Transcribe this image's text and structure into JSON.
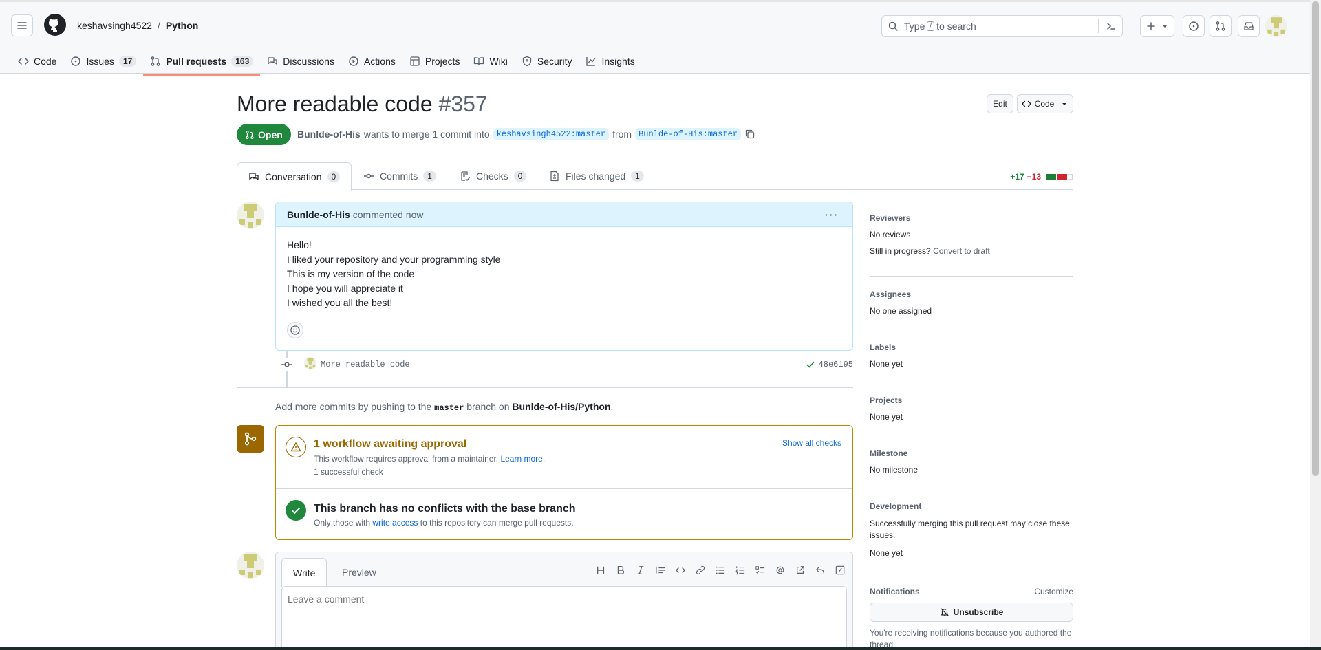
{
  "header": {
    "owner": "keshavsingh4522",
    "separator": "/",
    "repo": "Python",
    "search_placeholder_prefix": "Type",
    "search_key": "/",
    "search_placeholder_suffix": "to search"
  },
  "repo_nav": [
    {
      "label": "Code",
      "icon": "code-icon"
    },
    {
      "label": "Issues",
      "count": "17",
      "icon": "issue-icon"
    },
    {
      "label": "Pull requests",
      "count": "163",
      "icon": "pull-request-icon",
      "active": true
    },
    {
      "label": "Discussions",
      "icon": "discussions-icon"
    },
    {
      "label": "Actions",
      "icon": "play-icon"
    },
    {
      "label": "Projects",
      "icon": "table-icon"
    },
    {
      "label": "Wiki",
      "icon": "book-icon"
    },
    {
      "label": "Security",
      "icon": "shield-icon"
    },
    {
      "label": "Insights",
      "icon": "graph-icon"
    }
  ],
  "pr": {
    "title": "More readable code",
    "number": "#357",
    "edit_label": "Edit",
    "code_label": "Code",
    "state": "Open",
    "author": "Bunlde-of-His",
    "merge_text": "wants to merge 1 commit into",
    "base_branch": "keshavsingh4522:master",
    "from_text": "from",
    "head_branch": "Bunlde-of-His:master"
  },
  "tabs": [
    {
      "label": "Conversation",
      "count": "0",
      "icon": "conversation-icon"
    },
    {
      "label": "Commits",
      "count": "1",
      "icon": "commit-icon"
    },
    {
      "label": "Checks",
      "count": "0",
      "icon": "checklist-icon"
    },
    {
      "label": "Files changed",
      "count": "1",
      "icon": "file-diff-icon"
    }
  ],
  "diffstat": {
    "additions": "+17",
    "deletions": "−13",
    "colors": [
      "#1a7f37",
      "#1a7f37",
      "#d1242f",
      "#d1242f",
      "#ffffff"
    ]
  },
  "comment": {
    "author": "Bunlde-of-His",
    "meta": "commented now",
    "lines": [
      "Hello!",
      "I liked your repository and your programming style",
      "This is my version of the code",
      "I hope you will appreciate it",
      "I wished you all the best!"
    ]
  },
  "commit": {
    "message": "More readable code",
    "sha": "48e6195"
  },
  "push_hint": {
    "prefix": "Add more commits by pushing to the",
    "branch": "master",
    "middle": "branch on",
    "repo": "Bunlde-of-His/Python",
    "suffix": "."
  },
  "merge_box": {
    "workflow_title": "1 workflow awaiting approval",
    "workflow_desc": "This workflow requires approval from a maintainer.",
    "learn_more": "Learn more.",
    "checks_count": "1 successful check",
    "show_all": "Show all checks",
    "conflict_title": "This branch has no conflicts with the base branch",
    "conflict_prefix": "Only those with",
    "conflict_link": "write access",
    "conflict_suffix": "to this repository can merge pull requests."
  },
  "form": {
    "write_tab": "Write",
    "preview_tab": "Preview",
    "placeholder": "Leave a comment",
    "toolbar": [
      "heading-icon",
      "bold-icon",
      "italic-icon",
      "quote-icon",
      "code-icon",
      "link-icon",
      "bullet-list-icon",
      "numbered-list-icon",
      "task-list-icon",
      "mention-icon",
      "cross-reference-icon",
      "reply-icon",
      "slash-command-icon"
    ]
  },
  "sidebar": {
    "reviewers_h": "Reviewers",
    "reviewers_v": "No reviews",
    "draft_prefix": "Still in progress?",
    "draft_link": "Convert to draft",
    "assignees_h": "Assignees",
    "assignees_v": "No one assigned",
    "labels_h": "Labels",
    "labels_v": "None yet",
    "projects_h": "Projects",
    "projects_v": "None yet",
    "milestone_h": "Milestone",
    "milestone_v": "No milestone",
    "development_h": "Development",
    "development_desc": "Successfully merging this pull request may close these issues.",
    "development_v": "None yet",
    "notifications_h": "Notifications",
    "customize": "Customize",
    "unsubscribe": "Unsubscribe",
    "notif_desc": "You're receiving notifications because you authored the thread."
  },
  "colors": {
    "accent": "#0969da",
    "open_green": "#1f883d",
    "warning": "#9a6700",
    "nav_underline": "#fd8c73"
  }
}
